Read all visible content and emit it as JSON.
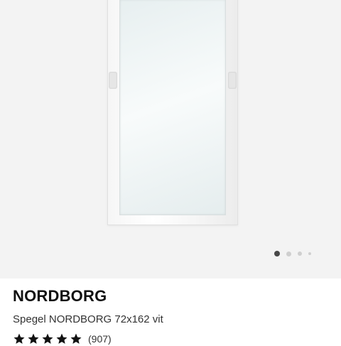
{
  "product": {
    "brand": "NORDBORG",
    "name": "Spegel NORDBORG 72x162 vit",
    "review_count": "(907)",
    "rating_stars": 5
  },
  "carousel": {
    "total_images": 4,
    "active_index": 1
  },
  "colors": {
    "image_background": "#f3f3f3",
    "active_dot": "#484848",
    "inactive_dot": "#cfcfcf",
    "star": "#111111"
  },
  "icons": {
    "rating": "star-icon"
  }
}
